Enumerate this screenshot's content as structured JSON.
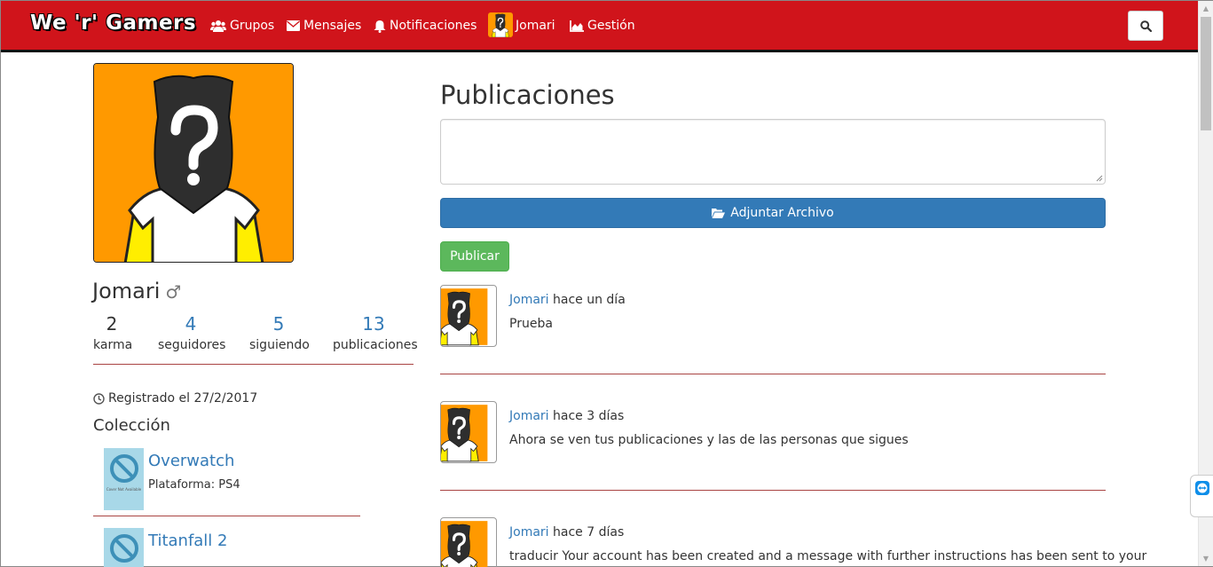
{
  "nav": {
    "brand": "We 'r' Gamers",
    "groups": "Grupos",
    "messages": "Mensajes",
    "notifications": "Notificaciones",
    "user": "Jomari",
    "admin": "Gestión",
    "search_icon": "search-icon"
  },
  "profile": {
    "name": "Jomari",
    "gender_symbol": "♂",
    "stats": [
      {
        "value": "2",
        "label": "karma"
      },
      {
        "value": "4",
        "label": "seguidores"
      },
      {
        "value": "5",
        "label": "siguiendo"
      },
      {
        "value": "13",
        "label": "publicaciones"
      }
    ],
    "registered": "Registrado el 27/2/2017",
    "collection_title": "Colección",
    "games": [
      {
        "name": "Overwatch",
        "platform": "Plataforma: PS4",
        "thumb_text": "Cover Not Available"
      },
      {
        "name": "Titanfall 2",
        "platform": "",
        "thumb_text": ""
      }
    ]
  },
  "posts_section": {
    "title": "Publicaciones",
    "textarea_value": "",
    "attach_label": "Adjuntar Archivo",
    "publish_label": "Publicar"
  },
  "posts": [
    {
      "author": "Jomari",
      "time": "hace un día",
      "text": "Prueba"
    },
    {
      "author": "Jomari",
      "time": "hace 3 días",
      "text": "Ahora se ven tus publicaciones y las de las personas que sigues"
    },
    {
      "author": "Jomari",
      "time": "hace 7 días",
      "text": "traducir Your account has been created and a message with further instructions has been sent to your"
    }
  ],
  "colors": {
    "navbar": "#d0141b",
    "link": "#337ab7",
    "primary_button": "#337ab7",
    "success_button": "#5cb85c",
    "divider": "#a94442",
    "avatar_bg": "#ff9900"
  }
}
